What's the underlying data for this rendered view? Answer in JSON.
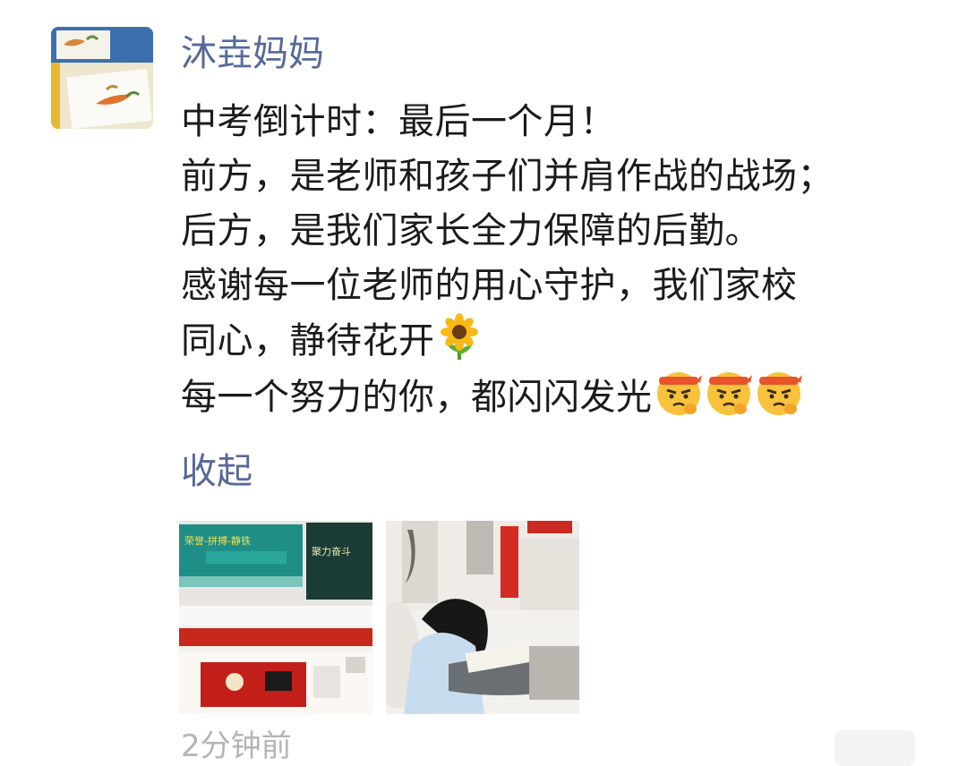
{
  "post": {
    "author": "沐垚妈妈",
    "lines": [
      "中考倒计时：最后一个月！",
      "前方，是老师和孩子们并肩作战的战场；",
      "后方，是我们家长全力保障的后勤。",
      "感谢每一位老师的用心守护，我们家校",
      "同心，静待花开",
      "每一个努力的你，都闪闪发光"
    ],
    "emoji_sunflower": "sunflower",
    "emoji_determined": "determined-face-headband",
    "collapse_label": "收起",
    "timestamp": "2分钟前"
  },
  "photos": [
    {
      "name": "classroom-photo",
      "banner_text": "荣誉-拼搏-静铁",
      "board_text": "聚力奋斗"
    },
    {
      "name": "student-studying-photo"
    }
  ],
  "colors": {
    "author": "#57699a",
    "text": "#1b1b1b",
    "link": "#57699a",
    "meta": "#b5b5b5"
  }
}
